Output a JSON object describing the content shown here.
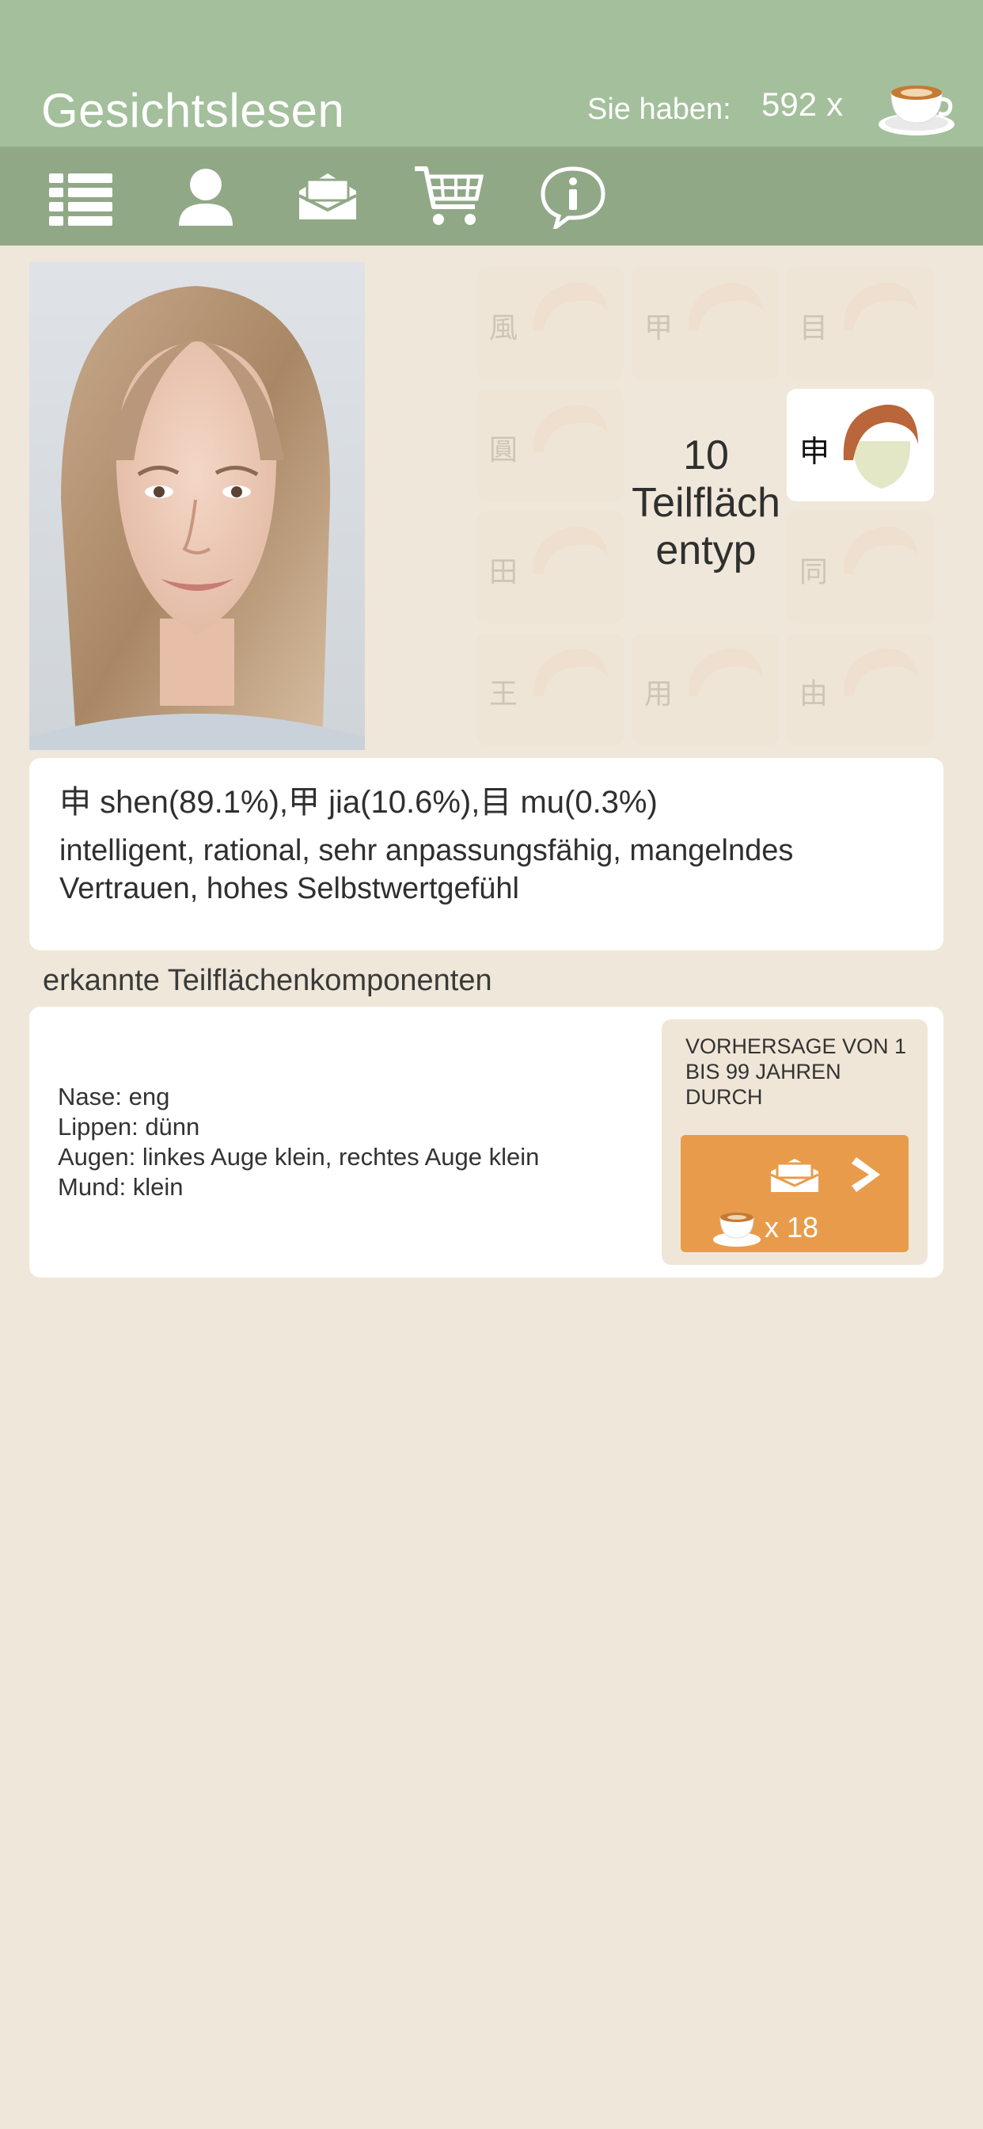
{
  "header": {
    "title": "Gesichtslesen",
    "have_label": "Sie haben:",
    "coins": "592",
    "coin_multiplier": "x"
  },
  "toolbar": {
    "icons": [
      "list-icon",
      "profile-icon",
      "mail-icon",
      "cart-icon",
      "info-icon"
    ]
  },
  "grid": {
    "tiles": [
      {
        "char": "風",
        "active": false
      },
      {
        "char": "甲",
        "active": false
      },
      {
        "char": "目",
        "active": false
      },
      {
        "char": "圓",
        "active": false
      },
      {
        "char": "申",
        "active": true
      },
      {
        "char": "田",
        "active": false
      },
      {
        "char": "同",
        "active": false
      },
      {
        "char": "王",
        "active": false
      },
      {
        "char": "用",
        "active": false
      },
      {
        "char": "由",
        "active": false
      }
    ],
    "center_label": "10 Teilfläch entyp"
  },
  "result": {
    "probabilities": "申 shen(89.1%),甲 jia(10.6%),目 mu(0.3%)",
    "traits": "intelligent, rational, sehr anpassungsfähig, mangelndes Vertrauen, hohes Selbstwertgefühl"
  },
  "components": {
    "title": "erkannte Teilflächenkomponenten",
    "items": [
      "Nase: eng",
      "Lippen: dünn",
      "Augen: linkes Auge klein, rechtes Auge klein",
      "Mund: klein"
    ]
  },
  "prediction": {
    "text": "VORHERSAGE VON 1 BIS 99 JAHREN DURCH",
    "cost": "x 18"
  },
  "colors": {
    "header": "#a3bf9b",
    "toolbar": "#91a887",
    "background": "#efe7d9",
    "button": "#e89c4b"
  }
}
